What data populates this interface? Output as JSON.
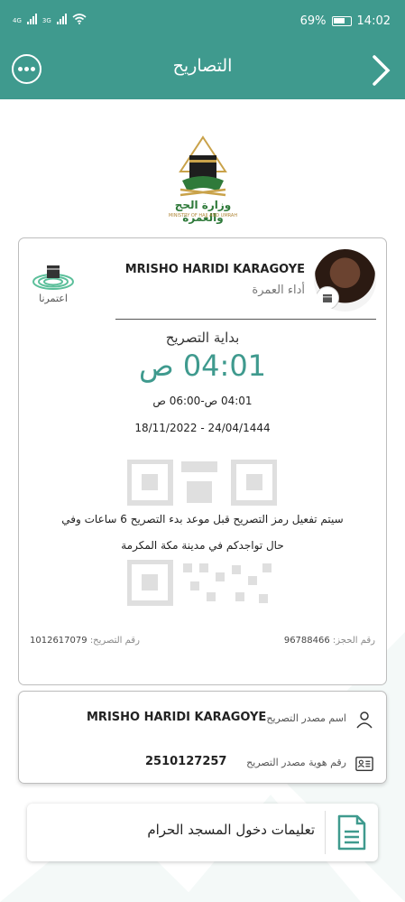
{
  "status_bar": {
    "network_1": "4G",
    "network_2": "3G",
    "battery": "69%",
    "time": "14:02"
  },
  "app_bar": {
    "title": "التصاريح",
    "more_icon": "more-horizontal-icon",
    "back_icon": "chevron-right-icon"
  },
  "logo": {
    "arabic": "وزارة الحج والعمرة",
    "english": "MINISTRY OF HAJJ AND UMRAH"
  },
  "permit": {
    "name": "MRISHO HARIDI KARAGOYE",
    "type": "أداء العمرة",
    "brand_label": "اعتمرنا",
    "start_label": "بداية التصريح",
    "start_time": "04:01 ص",
    "time_range": "04:01 ص-06:00 ص",
    "dates": "18/11/2022 - 24/04/1444",
    "notice_line1": "سيتم تفعيل رمز التصريح قبل موعد بدء التصريح 6  ساعات وفي",
    "notice_line2": "حال تواجدكم في مدينة  مكة المكرمة",
    "booking_label": "رقم الحجز:",
    "booking_number": "96788466",
    "permit_label": "رقم التصريح:",
    "permit_number": "1012617079"
  },
  "source": {
    "name_label": "اسم مصدر التصريح",
    "name_value": "MRISHO HARIDI  KARAGOYE",
    "id_label": "رقم هوية مصدر التصريح",
    "id_value": "2510127257"
  },
  "instructions": {
    "label": "تعليمات دخول المسجد الحرام"
  },
  "colors": {
    "primary": "#3f9a8e"
  }
}
